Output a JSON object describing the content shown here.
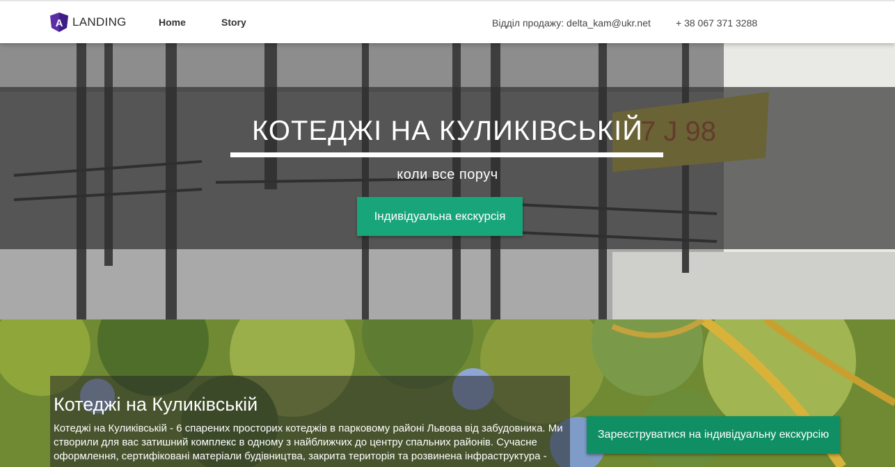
{
  "navbar": {
    "brand_letter": "A",
    "brand_text": "LANDING",
    "links": [
      {
        "label": "Home"
      },
      {
        "label": "Story"
      }
    ],
    "sales_contact": "Відділ продажу: delta_kam@ukr.net",
    "phone": "+ 38 067 371 3288"
  },
  "hero": {
    "title": "КОТЕДЖІ НА КУЛИКІВСЬКІЙ",
    "subtitle": "коли все поруч",
    "cta_label": "Індивідуальна екскурсія"
  },
  "about": {
    "title": "Котеджі на Куликівській",
    "text": "Котеджі на Куликівській - 6 спарених просторих котеджів в парковому районі Львова від забудовника. Ми створили для вас затишний комплекс в одному з найближчих до центру спальних районів. Сучасне оформлення, сертифіковані матеріали будівництва, закрита територія та розвинена інфраструктура -",
    "register_label": "Зареєструватися на індивідуальну екскурсію"
  },
  "colors": {
    "primary_button": "#18a57a",
    "secondary_button": "#0f8f63",
    "brand_logo": "#5a2ea6"
  },
  "icons": {
    "brand": "angular-logo-icon"
  }
}
